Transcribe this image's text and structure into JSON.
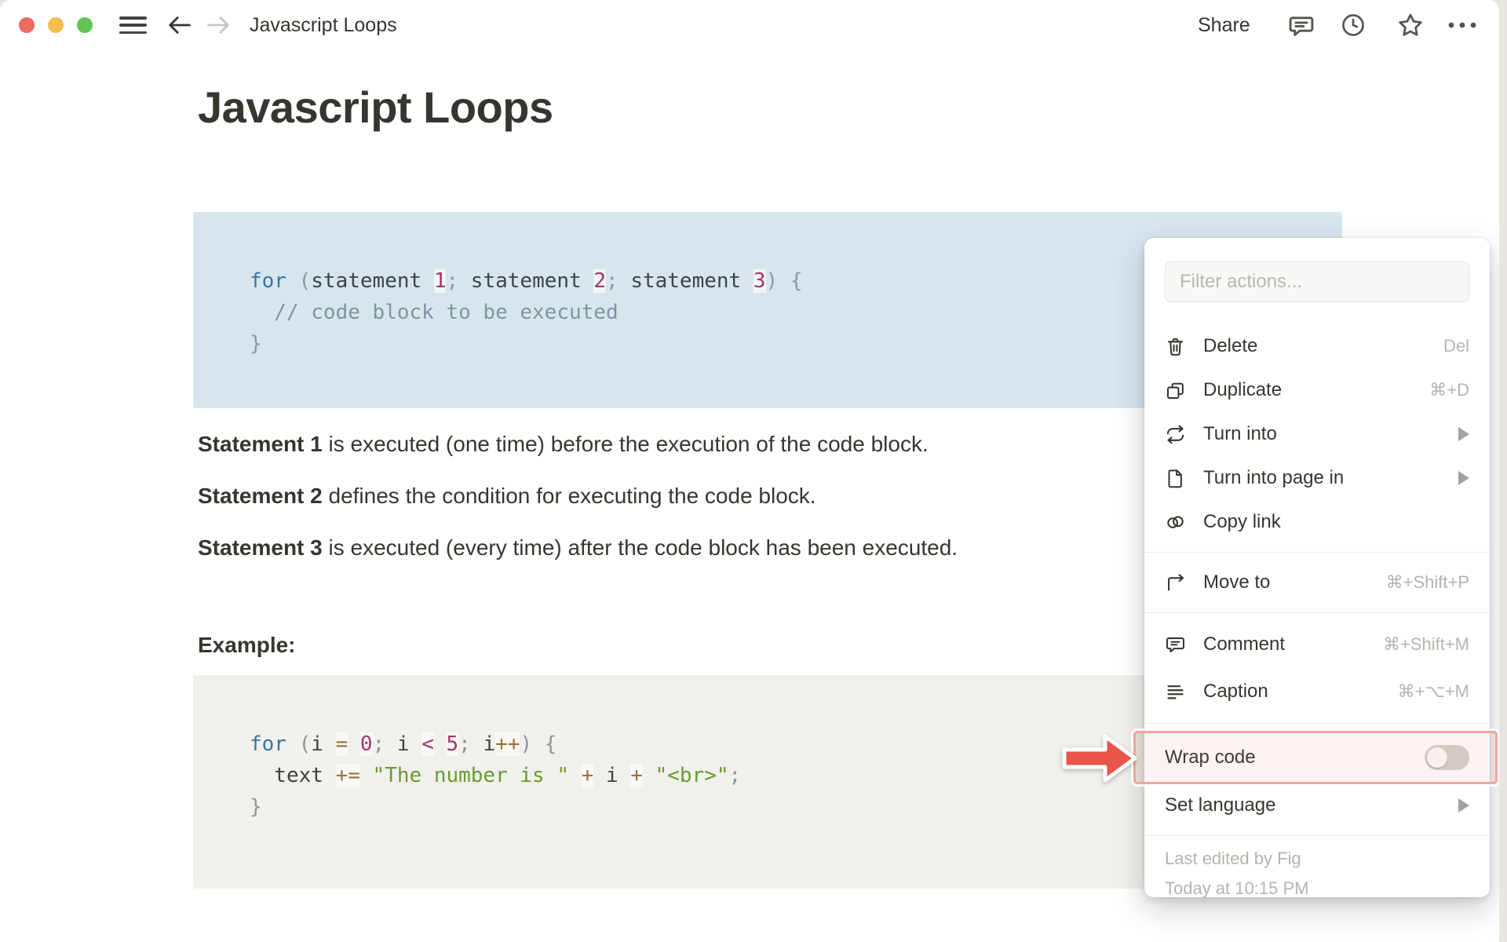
{
  "topbar": {
    "title": "Javascript Loops",
    "share_label": "Share"
  },
  "document": {
    "title": "Javascript Loops",
    "paragraphs": [
      {
        "bold": "Statement 1",
        "rest": " is executed (one time) before the execution of the code block."
      },
      {
        "bold": "Statement 2",
        "rest": " defines the condition for executing the code block."
      },
      {
        "bold": "Statement 3",
        "rest": " is executed (every time) after the code block has been executed."
      }
    ],
    "example_label": "Example:"
  },
  "code_blocks": [
    {
      "background": "#d7e6ee",
      "lines": [
        [
          {
            "t": "for",
            "c": "kw"
          },
          {
            "t": " ",
            "c": "pl"
          },
          {
            "t": "(",
            "c": "pu"
          },
          {
            "t": "statement ",
            "c": "pl"
          },
          {
            "t": "1",
            "c": "num"
          },
          {
            "t": "; ",
            "c": "pu"
          },
          {
            "t": "statement ",
            "c": "pl"
          },
          {
            "t": "2",
            "c": "num"
          },
          {
            "t": "; ",
            "c": "pu"
          },
          {
            "t": "statement ",
            "c": "pl"
          },
          {
            "t": "3",
            "c": "num"
          },
          {
            "t": ") ",
            "c": "pu"
          },
          {
            "t": "{",
            "c": "pu"
          }
        ],
        [
          {
            "t": "  // code block to be executed",
            "c": "cm"
          }
        ],
        [
          {
            "t": "}",
            "c": "pu"
          }
        ]
      ]
    },
    {
      "background": "#f1f0ea",
      "lines": [
        [
          {
            "t": "for",
            "c": "kw"
          },
          {
            "t": " ",
            "c": "pl"
          },
          {
            "t": "(",
            "c": "pu"
          },
          {
            "t": "i ",
            "c": "pl"
          },
          {
            "t": "=",
            "c": "op"
          },
          {
            "t": " ",
            "c": "pl"
          },
          {
            "t": "0",
            "c": "num"
          },
          {
            "t": "; ",
            "c": "pu"
          },
          {
            "t": "i ",
            "c": "pl"
          },
          {
            "t": "<",
            "c": "num"
          },
          {
            "t": " ",
            "c": "pl"
          },
          {
            "t": "5",
            "c": "num"
          },
          {
            "t": "; ",
            "c": "pu"
          },
          {
            "t": "i",
            "c": "pl"
          },
          {
            "t": "++",
            "c": "op"
          },
          {
            "t": ") ",
            "c": "pu"
          },
          {
            "t": "{",
            "c": "pu"
          }
        ],
        [
          {
            "t": "  text ",
            "c": "pl"
          },
          {
            "t": "+=",
            "c": "op"
          },
          {
            "t": " ",
            "c": "pl"
          },
          {
            "t": "\"The number is \"",
            "c": "str"
          },
          {
            "t": " ",
            "c": "pl"
          },
          {
            "t": "+",
            "c": "op"
          },
          {
            "t": " i ",
            "c": "pl"
          },
          {
            "t": "+",
            "c": "op"
          },
          {
            "t": " ",
            "c": "pl"
          },
          {
            "t": "\"<br>\"",
            "c": "str"
          },
          {
            "t": ";",
            "c": "pu"
          }
        ],
        [
          {
            "t": "}",
            "c": "pu"
          }
        ]
      ]
    }
  ],
  "menu": {
    "filter_placeholder": "Filter actions...",
    "items": [
      {
        "label": "Delete",
        "shortcut": "Del"
      },
      {
        "label": "Duplicate",
        "shortcut": "⌘+D"
      },
      {
        "label": "Turn into",
        "submenu": true
      },
      {
        "label": "Turn into page in",
        "submenu": true
      },
      {
        "label": "Copy link"
      },
      {
        "label": "Move to",
        "shortcut": "⌘+Shift+P"
      },
      {
        "label": "Comment",
        "shortcut": "⌘+Shift+M"
      },
      {
        "label": "Caption",
        "shortcut": "⌘+⌥+M"
      },
      {
        "label": "Wrap code",
        "toggle": "off"
      },
      {
        "label": "Set language",
        "submenu": true
      }
    ],
    "footer": [
      "Last edited by Fig",
      "Today at 10:15 PM"
    ]
  },
  "colors": {
    "accent_arrow": "#e9544b",
    "annotation_border": "#eda79f",
    "code_bg_blue": "#d7e6ee",
    "code_bg_beige": "#f1f0ea",
    "text": "#37352f"
  }
}
